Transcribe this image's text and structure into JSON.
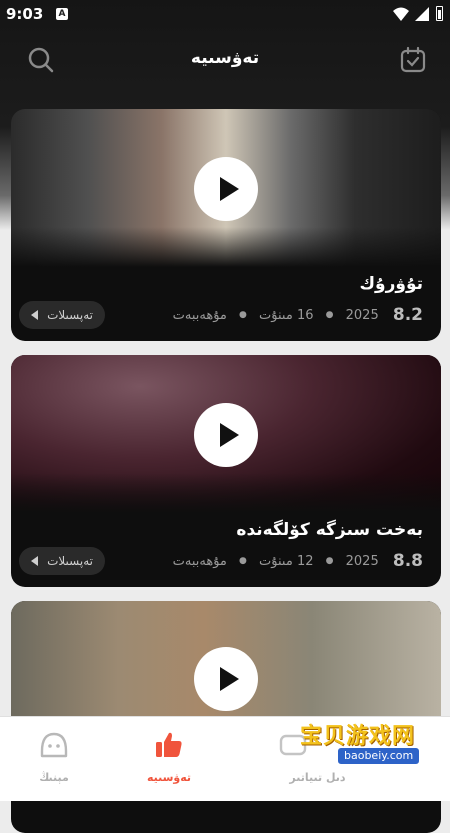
{
  "status_bar": {
    "time": "9:03",
    "notification": "A"
  },
  "header": {
    "title": "تەۋسىيە"
  },
  "cards": [
    {
      "title": "تۇۋرۇك",
      "rating": "8.2",
      "year": "2025",
      "episodes": "16 مىنۇت",
      "type": "مۇھەببەت",
      "details_label": "تەپسىلات"
    },
    {
      "title": "بەخت سىزگە كۆلگەندە",
      "rating": "8.8",
      "year": "2025",
      "episodes": "12 مىنۇت",
      "type": "مۇھەببەت",
      "details_label": "تەپسىلات"
    },
    {
      "title": "",
      "rating": "",
      "year": "",
      "episodes": "",
      "type": "",
      "details_label": ""
    }
  ],
  "nav": {
    "items": [
      {
        "label": "مېنىڭ",
        "icon": "face-icon"
      },
      {
        "label": "تەۋسىيە",
        "icon": "thumbs-up-icon",
        "active": true
      },
      {
        "label": "دىل تىياتىر",
        "icon": "theater-icon"
      }
    ]
  },
  "watermark": {
    "text": "宝贝游戏网",
    "url": "baobeiy.com"
  },
  "colors": {
    "accent": "#f0543c",
    "background": "#ececec",
    "card": "#0e0e0e"
  }
}
